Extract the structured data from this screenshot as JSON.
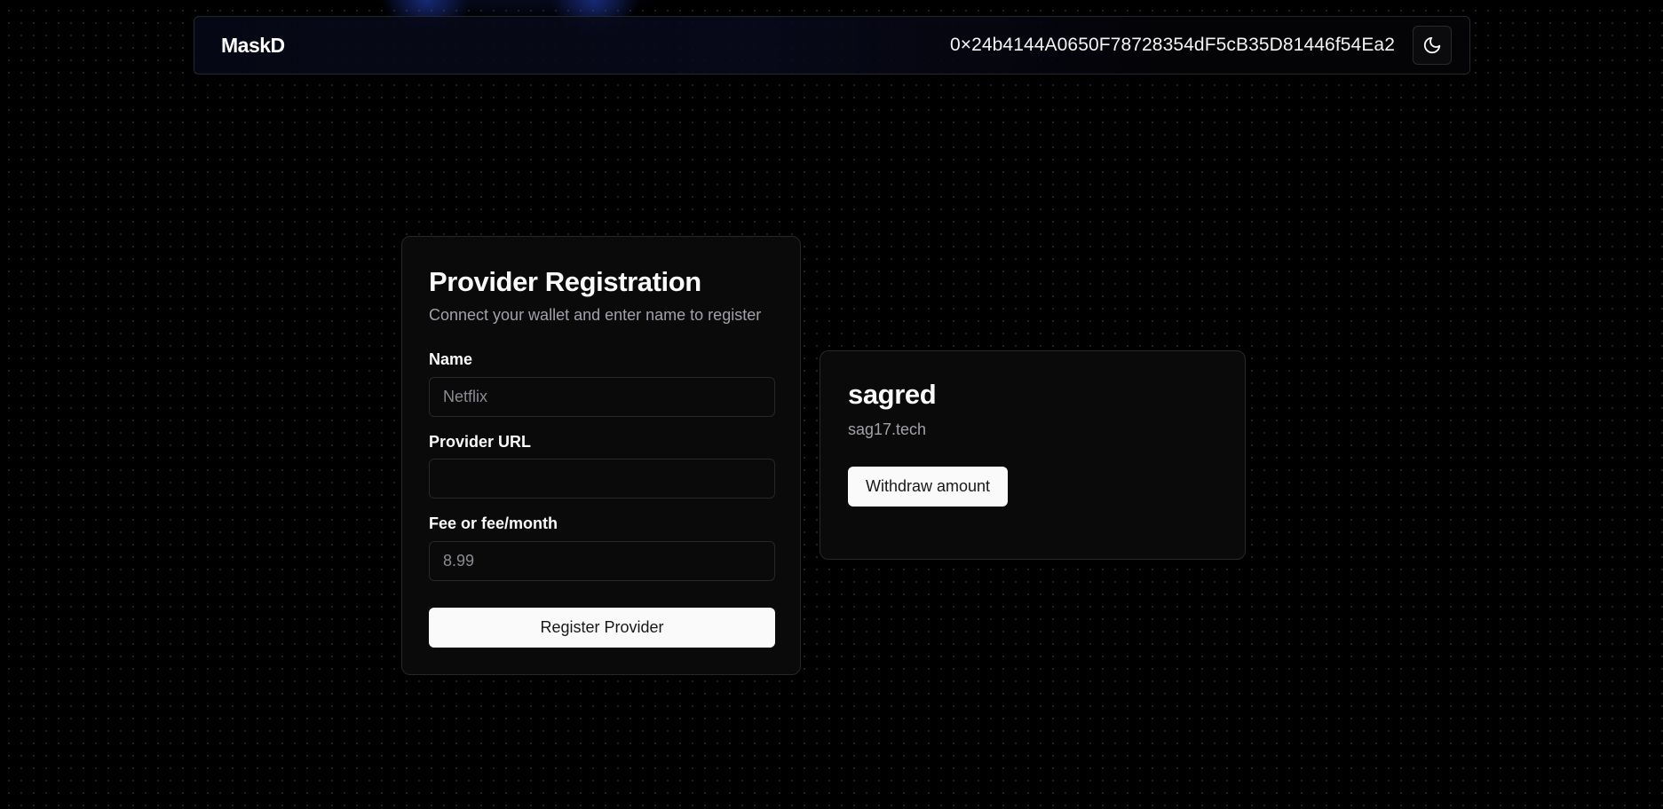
{
  "header": {
    "brand": "MaskD",
    "wallet_address": "0×24b4144A0650F78728354dF5cB35D81446f54Ea2",
    "theme_toggle_icon": "moon-icon"
  },
  "registration": {
    "title": "Provider Registration",
    "subtitle": "Connect your wallet and enter name to register",
    "fields": [
      {
        "label": "Name",
        "value": "",
        "placeholder": "Netflix"
      },
      {
        "label": "Provider URL",
        "value": "",
        "placeholder": ""
      },
      {
        "label": "Fee or fee/month",
        "value": "",
        "placeholder": "8.99"
      }
    ],
    "submit_label": "Register Provider"
  },
  "provider": {
    "name": "sagred",
    "url": "sag17.tech",
    "withdraw_label": "Withdraw amount"
  }
}
